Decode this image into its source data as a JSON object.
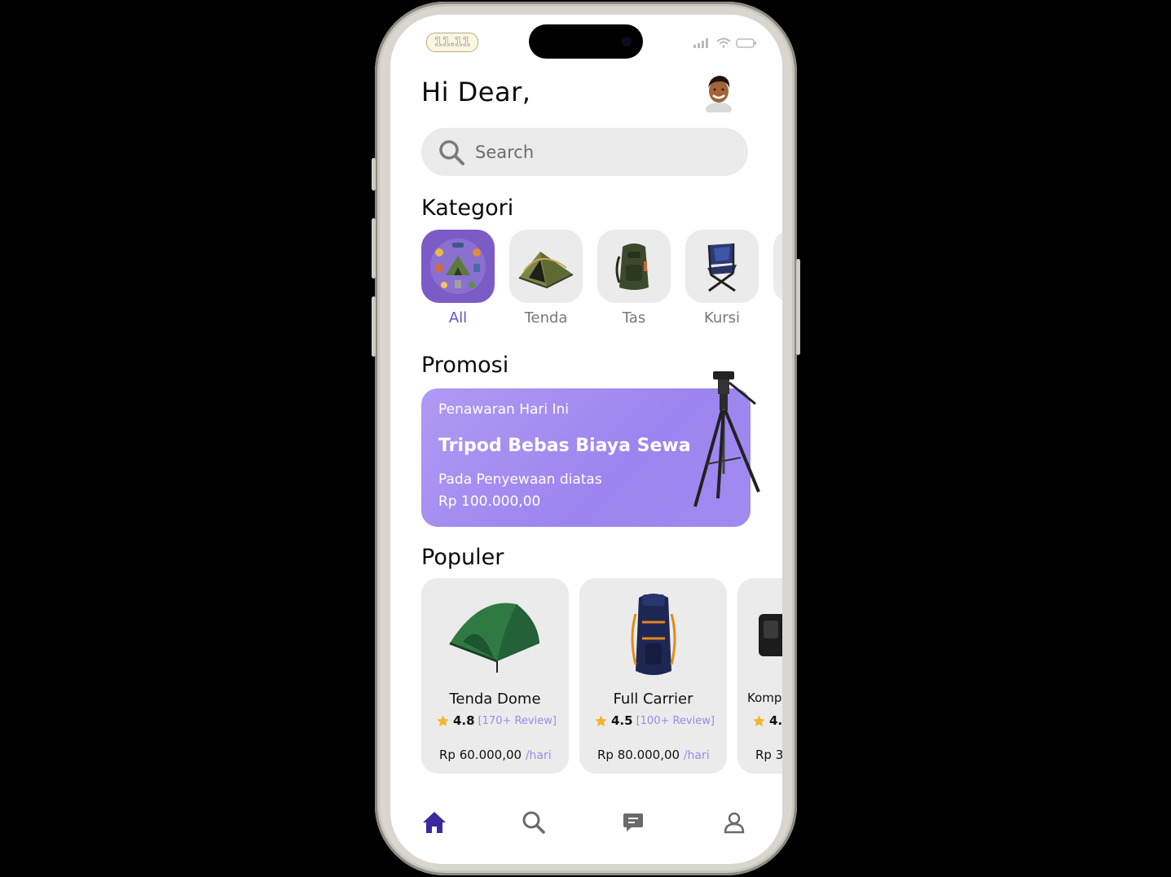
{
  "status": {
    "time": "11.11"
  },
  "header": {
    "greeting": "Hi Dear,"
  },
  "search": {
    "placeholder": "Search"
  },
  "categories": {
    "title": "Kategori",
    "items": [
      {
        "label": "All",
        "active": true
      },
      {
        "label": "Tenda",
        "active": false
      },
      {
        "label": "Tas",
        "active": false
      },
      {
        "label": "Kursi",
        "active": false
      }
    ]
  },
  "promo": {
    "title": "Promosi",
    "subtitle": "Penawaran Hari Ini",
    "headline": "Tripod Bebas Biaya Sewa",
    "line1": "Pada Penyewaan diatas",
    "line2": "Rp 100.000,00"
  },
  "popular": {
    "title": "Populer",
    "items": [
      {
        "name": "Tenda Dome",
        "rating": "4.8",
        "reviews": "[170+ Review]",
        "price": "Rp 60.000,00",
        "unit": "/hari"
      },
      {
        "name": "Full Carrier",
        "rating": "4.5",
        "reviews": "[100+ Review]",
        "price": "Rp 80.000,00",
        "unit": "/hari"
      },
      {
        "name": "Komp",
        "rating": "4.",
        "reviews": "",
        "price": "Rp 3",
        "unit": ""
      }
    ]
  },
  "nav": {
    "items": [
      "home-icon",
      "search-icon",
      "chat-icon",
      "profile-icon"
    ],
    "active": "home-icon"
  },
  "colors": {
    "accent": "#7b5cc6",
    "promo": "#a08bf0",
    "nav_active": "#3a2a9e"
  }
}
